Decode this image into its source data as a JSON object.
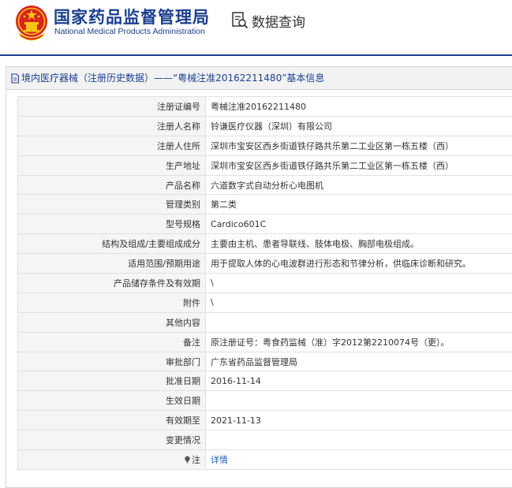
{
  "header": {
    "org_name": "国家药品监督管理局",
    "org_name_en": "National Medical Products Administration",
    "query_label": "数据查询",
    "brand_color": "#1b3f8f"
  },
  "panel": {
    "title": "境内医疗器械（注册历史数据）——“粤械注准20162211480”基本信息"
  },
  "rows": [
    {
      "label": "注册证编号",
      "value": "粤械注准20162211480"
    },
    {
      "label": "注册人名称",
      "value": "铃谦医疗仪器（深圳）有限公司"
    },
    {
      "label": "注册人住所",
      "value": "深圳市宝安区西乡街道铁仔路共乐第二工业区第一栋五楼（西）"
    },
    {
      "label": "生产地址",
      "value": "深圳市宝安区西乡街道铁仔路共乐第二工业区第一栋五楼（西）"
    },
    {
      "label": "产品名称",
      "value": "六道数字式自动分析心电图机"
    },
    {
      "label": "管理类别",
      "value": "第二类"
    },
    {
      "label": "型号规格",
      "value": "Cardico601C"
    },
    {
      "label": "结构及组成/主要组成成分",
      "value": "主要由主机、患者导联线、肢体电极、胸部电极组成。"
    },
    {
      "label": "适用范围/预期用途",
      "value": "用于提取人体的心电波群进行形态和节律分析，供临床诊断和研究。"
    },
    {
      "label": "产品储存条件及有效期",
      "value": "\\"
    },
    {
      "label": "附件",
      "value": "\\"
    },
    {
      "label": "其他内容",
      "value": ""
    },
    {
      "label": "备注",
      "value": "原注册证号：粤食药监械（准）字2012第2210074号（更）。"
    },
    {
      "label": "审批部门",
      "value": "广东省药品监督管理局"
    },
    {
      "label": "批准日期",
      "value": "2016-11-14"
    },
    {
      "label": "生效日期",
      "value": ""
    },
    {
      "label": "有效期至",
      "value": "2021-11-13"
    },
    {
      "label": "变更情况",
      "value": ""
    }
  ],
  "note_row": {
    "label": "注",
    "link_text": "详情",
    "icon": "pin-icon"
  }
}
